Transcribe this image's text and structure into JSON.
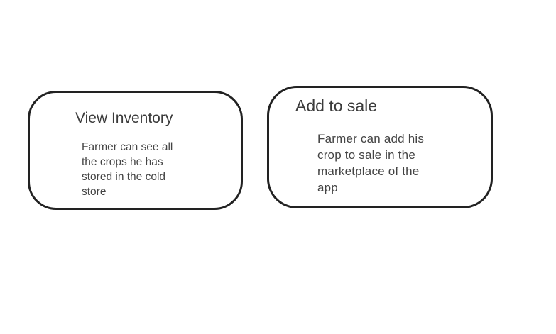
{
  "diagram": {
    "cards": [
      {
        "title": "View Inventory",
        "description": "Farmer can see all the crops he has stored in the cold store"
      },
      {
        "title": "Add to sale",
        "description": "Farmer can add his crop to sale in the marketplace of the app"
      }
    ]
  }
}
